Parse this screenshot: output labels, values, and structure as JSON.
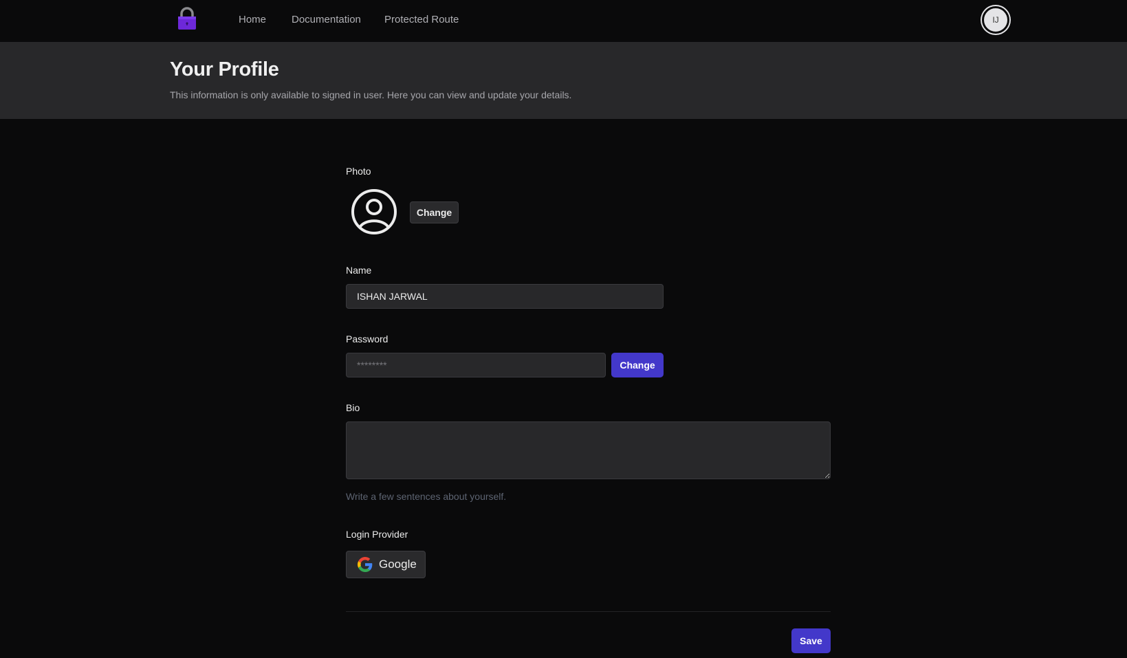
{
  "nav": {
    "logo_icon": "lock-icon",
    "links": [
      "Home",
      "Documentation",
      "Protected Route"
    ],
    "avatar_initials": "IJ"
  },
  "header": {
    "title": "Your Profile",
    "subtitle": "This information is only available to signed in user. Here you can view and update your details."
  },
  "form": {
    "photo": {
      "label": "Photo",
      "icon": "user-circle-icon",
      "change_label": "Change"
    },
    "name": {
      "label": "Name",
      "value": "ISHAN JARWAL"
    },
    "password": {
      "label": "Password",
      "placeholder": "********",
      "change_label": "Change"
    },
    "bio": {
      "label": "Bio",
      "value": "",
      "hint": "Write a few sentences about yourself."
    },
    "login_provider": {
      "label": "Login Provider",
      "provider": "Google",
      "icon": "google-icon"
    },
    "save_label": "Save"
  },
  "colors": {
    "background": "#0a0a0b",
    "header_band": "#28282a",
    "primary": "#4338ca",
    "lock": "#6d28d9"
  }
}
